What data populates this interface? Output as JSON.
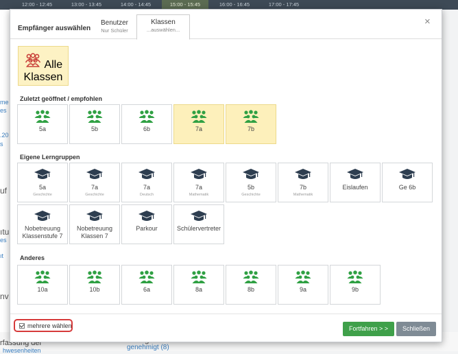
{
  "background": {
    "time_slots": [
      "12:00 - 12:45",
      "13:00 - 13:45",
      "14:00 - 14:45",
      "15:00 - 15:45",
      "16:00 - 16:45",
      "17:00 - 17:45"
    ],
    "fragments": [
      "me",
      "es",
      ".20",
      "s",
      "uf",
      "ıtu",
      "es",
      "ıt",
      "nv"
    ],
    "bottom_left": "rfassung der",
    "bottom_left2": "hwesenheiten",
    "bottom_mid": "Anträge",
    "bottom_mid2": "genehmigt (8)"
  },
  "modal": {
    "title": "Empfänger auswählen",
    "tabs": [
      {
        "label": "Benutzer",
        "sub": "Nur Schüler"
      },
      {
        "label": "Klassen",
        "sub": "...auswählen..."
      }
    ],
    "close_glyph": "×",
    "all_classes": {
      "label": "Alle Klassen",
      "icon": "group-icon"
    },
    "recent": {
      "heading": "Zuletzt geöffnet / empfohlen",
      "items": [
        {
          "label": "5a",
          "selected": false
        },
        {
          "label": "5b",
          "selected": false
        },
        {
          "label": "6b",
          "selected": false
        },
        {
          "label": "7a",
          "selected": true
        },
        {
          "label": "7b",
          "selected": true
        }
      ]
    },
    "groups": {
      "heading": "Eigene Lerngruppen",
      "row1": [
        {
          "label": "5a",
          "sub": "Geschichte"
        },
        {
          "label": "7a",
          "sub": "Geschichte"
        },
        {
          "label": "7a",
          "sub": "Deutsch"
        },
        {
          "label": "7a",
          "sub": "Mathematik"
        },
        {
          "label": "5b",
          "sub": "Geschichte"
        },
        {
          "label": "7b",
          "sub": "Mathematik"
        },
        {
          "label": "Eislaufen",
          "sub": ""
        },
        {
          "label": "Ge 6b",
          "sub": ""
        }
      ],
      "row2": [
        {
          "label": "Nobetreuung",
          "label2": "Klassenstufe 7"
        },
        {
          "label": "Nobetreuung",
          "label2": "Klassen 7"
        },
        {
          "label": "Parkour",
          "label2": ""
        },
        {
          "label": "Schülervertreter",
          "label2": ""
        }
      ]
    },
    "other": {
      "heading": "Anderes",
      "items": [
        "10a",
        "10b",
        "6a",
        "8a",
        "8b",
        "9a",
        "9b"
      ]
    },
    "footer": {
      "multi_select_label": "mehrere wählen",
      "multi_select_checked": true,
      "continue_label": "Fortfahren > >",
      "close_label": "Schließen"
    },
    "colors": {
      "group_green": "#2fa043",
      "group_red": "#c9413a",
      "cap_dark": "#2e3e50",
      "selected_bg": "#fdf0bb",
      "continue_green": "#3fa04a"
    }
  }
}
